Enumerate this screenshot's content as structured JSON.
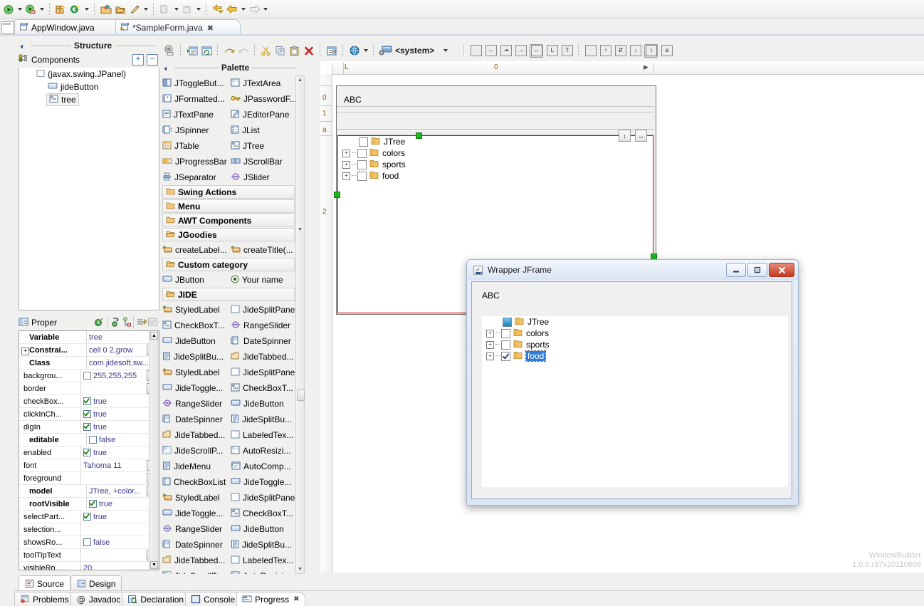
{
  "toolbar": {
    "groups": [
      {
        "items": [
          {
            "icon": "run-icon"
          },
          {
            "icon": "dropdown-arrow"
          },
          {
            "icon": "debug-icon"
          },
          {
            "icon": "dropdown-arrow"
          }
        ]
      },
      {
        "items": [
          {
            "icon": "new-java-package-icon"
          },
          {
            "icon": "new-class-icon"
          },
          {
            "icon": "dropdown-arrow"
          }
        ]
      },
      {
        "items": [
          {
            "icon": "open-type-icon"
          },
          {
            "icon": "open-resource-icon"
          },
          {
            "icon": "paint-icon"
          },
          {
            "icon": "dropdown-arrow"
          }
        ]
      },
      {
        "items": [
          {
            "icon": "import-icon"
          },
          {
            "icon": "dropdown-arrow"
          },
          {
            "icon": "export-icon"
          },
          {
            "icon": "dropdown-arrow"
          }
        ]
      },
      {
        "items": [
          {
            "icon": "back-history-icon"
          },
          {
            "icon": "back-icon"
          },
          {
            "icon": "dropdown-arrow"
          },
          {
            "icon": "forward-icon"
          },
          {
            "icon": "dropdown-arrow"
          }
        ]
      }
    ]
  },
  "editor_tabs": [
    {
      "label": "AppWindow.java",
      "active": false,
      "closable": false,
      "icon": "java-file-icon"
    },
    {
      "label": "*SampleForm.java",
      "active": true,
      "closable": true,
      "close_glyph": "✖",
      "icon": "java-form-file-icon"
    }
  ],
  "structure": {
    "title": "Structure",
    "components_label": "Components",
    "expand_all": "+",
    "collapse_all": "−",
    "tree": [
      {
        "label": "(javax.swing.JPanel)",
        "icon": "panel-icon",
        "indent": 0,
        "selected": false
      },
      {
        "label": "jideButton",
        "icon": "button-icon",
        "indent": 1,
        "selected": false
      },
      {
        "label": "tree",
        "icon": "tree-icon",
        "indent": 1,
        "selected": true
      }
    ]
  },
  "properties": {
    "title": "Proper",
    "toolbar_icons": [
      "show-events-icon",
      "goto-definition-icon",
      "show-advanced-icon",
      "restore-default-icon",
      "filter-icon",
      "properties-page-icon"
    ],
    "rows": [
      {
        "name": "Variable",
        "value": "tree",
        "bold": true,
        "type": "text"
      },
      {
        "name": "Constrai...",
        "value": "cell 0 2,grow",
        "bold": true,
        "type": "text",
        "expandable": true,
        "ellipsis": true
      },
      {
        "name": "Class",
        "value": "com.jidesoft.sw...",
        "bold": true,
        "type": "text"
      },
      {
        "name": "backgrou...",
        "value": "255,255,255",
        "bold": false,
        "type": "color",
        "swatch": "#ffffff",
        "ellipsis": true
      },
      {
        "name": "border",
        "value": "",
        "bold": false,
        "type": "text",
        "ellipsis": true
      },
      {
        "name": "checkBox...",
        "value": "true",
        "bold": false,
        "type": "bool",
        "checked": true
      },
      {
        "name": "clickInCh...",
        "value": "true",
        "bold": false,
        "type": "bool",
        "checked": true
      },
      {
        "name": "digIn",
        "value": "true",
        "bold": false,
        "type": "bool",
        "checked": true
      },
      {
        "name": "editable",
        "value": "false",
        "bold": true,
        "type": "bool",
        "checked": false
      },
      {
        "name": "enabled",
        "value": "true",
        "bold": false,
        "type": "bool",
        "checked": true
      },
      {
        "name": "font",
        "value": "Tahoma 11",
        "bold": false,
        "type": "text",
        "ellipsis": true
      },
      {
        "name": "foreground",
        "value": "",
        "bold": false,
        "type": "text",
        "ellipsis": true
      },
      {
        "name": "model",
        "value": "JTree, +color...",
        "bold": true,
        "type": "text",
        "ellipsis": true
      },
      {
        "name": "rootVisible",
        "value": "true",
        "bold": true,
        "type": "bool",
        "checked": true
      },
      {
        "name": "selectPart...",
        "value": "true",
        "bold": false,
        "type": "bool",
        "checked": true
      },
      {
        "name": "selection...",
        "value": "",
        "bold": false,
        "type": "text"
      },
      {
        "name": "showsRo...",
        "value": "false",
        "bold": false,
        "type": "bool",
        "checked": false
      },
      {
        "name": "toolTipText",
        "value": "",
        "bold": false,
        "type": "text",
        "ellipsis": true
      },
      {
        "name": "visibleRo...",
        "value": "20",
        "bold": false,
        "type": "text"
      },
      {
        "name": "",
        "value": "",
        "bold": false,
        "type": "text"
      }
    ]
  },
  "design_toolbar": {
    "left_icons": [
      "test-preview-icon",
      "open-source-icon",
      "refresh-icon",
      "undo-icon",
      "redo-icon",
      "cut-icon",
      "copy-icon",
      "paste-icon",
      "delete-icon",
      "layout-properties-icon",
      "locale-globe-icon",
      "dropdown-arrow"
    ],
    "locale_value": "<system>",
    "locale_icon": "system-look-and-feel-icon",
    "align_horizontal": [
      {
        "icon": "align-none-icon",
        "active": false
      },
      {
        "icon": "align-left-icon",
        "active": false
      },
      {
        "icon": "align-center-h-icon",
        "active": false
      },
      {
        "icon": "align-right-icon",
        "active": false
      },
      {
        "icon": "fill-horizontal-icon",
        "active": true
      },
      {
        "icon": "align-leading-icon",
        "active": false
      },
      {
        "icon": "align-trailing-icon",
        "active": false
      }
    ],
    "align_vertical": [
      {
        "icon": "align-none-v-icon",
        "active": false
      },
      {
        "icon": "align-top-icon",
        "active": false
      },
      {
        "icon": "align-center-v-icon",
        "active": false
      },
      {
        "icon": "align-bottom-icon",
        "active": false
      },
      {
        "icon": "fill-vertical-icon",
        "active": true
      },
      {
        "icon": "align-baseline-icon",
        "active": false
      }
    ]
  },
  "palette": {
    "title": "Palette",
    "sections": [
      {
        "type": "items",
        "items": [
          {
            "label": "JToggleBut...",
            "icon": "jtogglebutton-icon"
          },
          {
            "label": "JTextArea",
            "icon": "jtextarea-icon"
          },
          {
            "label": "JFormatted...",
            "icon": "jformattedtextfield-icon"
          },
          {
            "label": "JPasswordF...",
            "icon": "jpasswordfield-icon"
          },
          {
            "label": "JTextPane",
            "icon": "jtextpane-icon"
          },
          {
            "label": "JEditorPane",
            "icon": "jeditorpane-icon"
          },
          {
            "label": "JSpinner",
            "icon": "jspinner-icon"
          },
          {
            "label": "JList",
            "icon": "jlist-icon"
          },
          {
            "label": "JTable",
            "icon": "jtable-icon"
          },
          {
            "label": "JTree",
            "icon": "jtree-icon"
          },
          {
            "label": "JProgressBar",
            "icon": "jprogressbar-icon"
          },
          {
            "label": "JScrollBar",
            "icon": "jscrollbar-icon"
          },
          {
            "label": "JSeparator",
            "icon": "jseparator-icon"
          },
          {
            "label": "JSlider",
            "icon": "jslider-icon"
          }
        ]
      },
      {
        "type": "category",
        "label": "Swing Actions",
        "open": false
      },
      {
        "type": "category",
        "label": "Menu",
        "open": false
      },
      {
        "type": "category",
        "label": "AWT Components",
        "open": false
      },
      {
        "type": "category",
        "label": "JGoodies",
        "open": true
      },
      {
        "type": "items",
        "items": [
          {
            "label": "createLabel...",
            "icon": "factory-icon"
          },
          {
            "label": "createTitle(...",
            "icon": "factory-icon"
          }
        ]
      },
      {
        "type": "category",
        "label": "Custom category",
        "open": true
      },
      {
        "type": "items",
        "items": [
          {
            "label": "JButton",
            "icon": "jbutton-icon"
          },
          {
            "label": "Your name",
            "icon": "radio-icon"
          }
        ]
      },
      {
        "type": "category",
        "label": "JIDE",
        "open": true
      },
      {
        "type": "items",
        "items": [
          {
            "label": "StyledLabel",
            "icon": "styledlabel-icon"
          },
          {
            "label": "JideSplitPane",
            "icon": "splitpane-icon"
          },
          {
            "label": "CheckBoxT...",
            "icon": "checkboxtree-icon"
          },
          {
            "label": "RangeSlider",
            "icon": "rangeslider-icon"
          },
          {
            "label": "JideButton",
            "icon": "jidebutton-icon"
          },
          {
            "label": "DateSpinner",
            "icon": "datespinner-icon"
          },
          {
            "label": "JideSplitBu...",
            "icon": "jidesplitbutton-icon"
          },
          {
            "label": "JideTabbed...",
            "icon": "jidetabbedpane-icon"
          },
          {
            "label": "StyledLabel",
            "icon": "styledlabel-icon"
          },
          {
            "label": "JideSplitPane",
            "icon": "splitpane-icon"
          },
          {
            "label": "JideToggle...",
            "icon": "jidetogglebutton-icon"
          },
          {
            "label": "CheckBoxT...",
            "icon": "checkboxtree-icon"
          },
          {
            "label": "RangeSlider",
            "icon": "rangeslider-icon"
          },
          {
            "label": "JideButton",
            "icon": "jidebutton-icon"
          },
          {
            "label": "DateSpinner",
            "icon": "datespinner-icon"
          },
          {
            "label": "JideSplitBu...",
            "icon": "jidesplitbutton-icon"
          },
          {
            "label": "JideTabbed...",
            "icon": "jidetabbedpane-icon"
          },
          {
            "label": "LabeledTex...",
            "icon": "labeledtextfield-icon"
          },
          {
            "label": "JideScrollP...",
            "icon": "jidescrollpane-icon"
          },
          {
            "label": "AutoResizi...",
            "icon": "autoresizingtextarea-icon"
          },
          {
            "label": "JideMenu",
            "icon": "jidemenu-icon"
          },
          {
            "label": "AutoComp...",
            "icon": "autocompletion-icon"
          },
          {
            "label": "CheckBoxList",
            "icon": "checkboxlist-icon"
          },
          {
            "label": "JideToggle...",
            "icon": "jidetogglebutton-icon"
          },
          {
            "label": "StyledLabel",
            "icon": "styledlabel-icon"
          },
          {
            "label": "JideSplitPane",
            "icon": "splitpane-icon"
          },
          {
            "label": "JideToggle...",
            "icon": "jidetogglebutton-icon"
          },
          {
            "label": "CheckBoxT...",
            "icon": "checkboxtree-icon"
          },
          {
            "label": "RangeSlider",
            "icon": "rangeslider-icon"
          },
          {
            "label": "JideButton",
            "icon": "jidebutton-icon"
          },
          {
            "label": "DateSpinner",
            "icon": "datespinner-icon"
          },
          {
            "label": "JideSplitBu...",
            "icon": "jidesplitbutton-icon"
          },
          {
            "label": "JideTabbed...",
            "icon": "jidetabbedpane-icon"
          },
          {
            "label": "LabeledTex...",
            "icon": "labeledtextfield-icon"
          },
          {
            "label": "JideScrollP",
            "icon": "jidescrollpane-icon"
          },
          {
            "label": "AutoResizi",
            "icon": "autoresizingtextarea-icon"
          }
        ]
      }
    ]
  },
  "canvas": {
    "ruler_h_left": "L",
    "ruler_h_zero": "0",
    "ruler_h_right": "▶",
    "ruler_v_ticks": [
      "0",
      "1",
      "a",
      "2"
    ],
    "form": {
      "label": "ABC",
      "tree": [
        {
          "label": "JTree",
          "level": 0,
          "expander": false,
          "checked": false
        },
        {
          "label": "colors",
          "level": 1,
          "expander": true,
          "checked": false
        },
        {
          "label": "sports",
          "level": 1,
          "expander": true,
          "checked": false
        },
        {
          "label": "food",
          "level": 1,
          "expander": true,
          "checked": false
        }
      ],
      "selection_color": "#d00000",
      "handle_color": "#22b422",
      "resize_v_glyph": "↕",
      "resize_h_glyph": "↔"
    }
  },
  "jframe": {
    "title": "Wrapper JFrame",
    "icon": "java-coffee-icon",
    "minimize": "—",
    "maximize": "❐",
    "close": "✕",
    "label": "ABC",
    "tree": [
      {
        "label": "JTree",
        "level": 0,
        "expander": false,
        "checked": false,
        "root": true,
        "selected": false
      },
      {
        "label": "colors",
        "level": 1,
        "expander": true,
        "checked": false,
        "root": false,
        "selected": false
      },
      {
        "label": "sports",
        "level": 1,
        "expander": true,
        "checked": false,
        "root": false,
        "selected": false
      },
      {
        "label": "food",
        "level": 1,
        "expander": true,
        "checked": true,
        "root": false,
        "selected": true
      }
    ],
    "selection_bg": "#2f7bd8"
  },
  "bottom": {
    "source_design": [
      {
        "label": "Source",
        "active": true,
        "icon": "source-icon"
      },
      {
        "label": "Design",
        "active": false,
        "icon": "design-icon"
      }
    ],
    "views": [
      {
        "label": "Problems",
        "active": false,
        "icon": "problems-icon",
        "closable": false
      },
      {
        "label": "Javadoc",
        "active": false,
        "icon": "javadoc-icon",
        "closable": false
      },
      {
        "label": "Declaration",
        "active": false,
        "icon": "declaration-icon",
        "closable": false
      },
      {
        "label": "Console",
        "active": false,
        "icon": "console-icon",
        "closable": false
      },
      {
        "label": "Progress",
        "active": true,
        "icon": "progress-icon",
        "closable": true,
        "close_glyph": "✖"
      }
    ]
  },
  "watermark": {
    "name": "WindowBuilder",
    "version": "1.0.0.r37x20110608"
  }
}
